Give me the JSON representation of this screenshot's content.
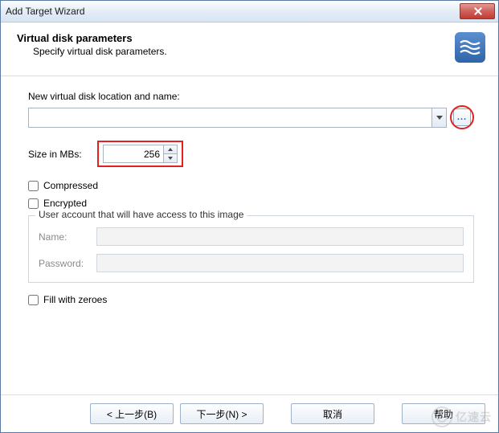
{
  "window": {
    "title": "Add Target Wizard"
  },
  "header": {
    "title": "Virtual disk parameters",
    "subtitle": "Specify virtual disk parameters."
  },
  "form": {
    "location_label": "New virtual disk location and name:",
    "location_value": "",
    "browse_label": "...",
    "size_label": "Size in MBs:",
    "size_value": "256",
    "compressed_label": "Compressed",
    "encrypted_label": "Encrypted",
    "fill_zero_label": "Fill with zeroes"
  },
  "group": {
    "title": "User account that will have access to this image",
    "name_label": "Name:",
    "name_value": "",
    "password_label": "Password:",
    "password_value": ""
  },
  "buttons": {
    "back": "< 上一步(B)",
    "next": "下一步(N) >",
    "cancel": "取消",
    "help": "帮助"
  },
  "watermark": "亿速云"
}
